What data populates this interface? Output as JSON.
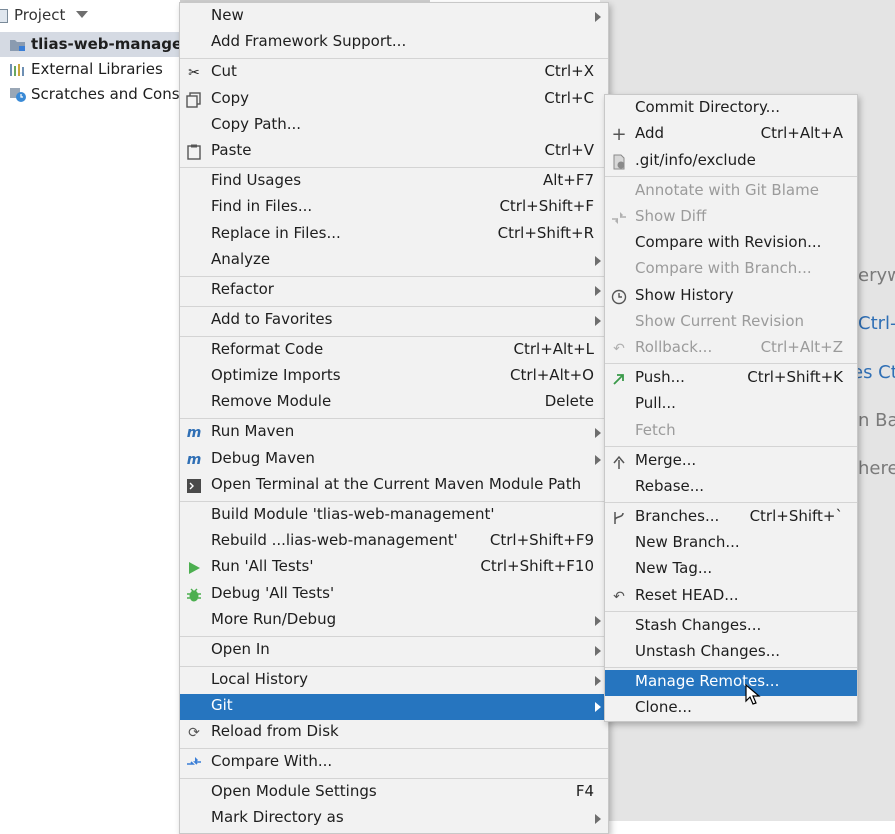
{
  "project_panel": {
    "title": "Project",
    "tree": [
      {
        "label": "tlias-web-management",
        "icon": "module-folder-icon"
      },
      {
        "label": "External Libraries",
        "icon": "libraries-icon"
      },
      {
        "label": "Scratches and Consoles",
        "icon": "scratches-icon"
      }
    ]
  },
  "editor_hints": [
    {
      "text": "eryw"
    },
    {
      "text": "Ctrl-"
    },
    {
      "text": "es Ct"
    },
    {
      "text": "n Ba"
    },
    {
      "text": "here"
    }
  ],
  "main_menu": [
    {
      "label": "New",
      "submenu": true
    },
    {
      "label": "Add Framework Support..."
    },
    {
      "label": "Cut",
      "shortcut": "Ctrl+X",
      "icon": "scissors-icon"
    },
    {
      "label": "Copy",
      "shortcut": "Ctrl+C",
      "icon": "copy-icon"
    },
    {
      "label": "Copy Path..."
    },
    {
      "label": "Paste",
      "shortcut": "Ctrl+V",
      "icon": "paste-icon"
    },
    {
      "label": "Find Usages",
      "shortcut": "Alt+F7"
    },
    {
      "label": "Find in Files...",
      "shortcut": "Ctrl+Shift+F"
    },
    {
      "label": "Replace in Files...",
      "shortcut": "Ctrl+Shift+R"
    },
    {
      "label": "Analyze",
      "submenu": true
    },
    {
      "label": "Refactor",
      "submenu": true
    },
    {
      "label": "Add to Favorites",
      "submenu": true
    },
    {
      "label": "Reformat Code",
      "shortcut": "Ctrl+Alt+L"
    },
    {
      "label": "Optimize Imports",
      "shortcut": "Ctrl+Alt+O"
    },
    {
      "label": "Remove Module",
      "shortcut": "Delete"
    },
    {
      "label": "Run Maven",
      "submenu": true,
      "icon": "maven-run-icon"
    },
    {
      "label": "Debug Maven",
      "submenu": true,
      "icon": "maven-debug-icon"
    },
    {
      "label": "Open Terminal at the Current Maven Module Path",
      "icon": "terminal-icon"
    },
    {
      "label": "Build Module 'tlias-web-management'"
    },
    {
      "label": "Rebuild ...lias-web-management'",
      "shortcut": "Ctrl+Shift+F9"
    },
    {
      "label": "Run 'All Tests'",
      "shortcut": "Ctrl+Shift+F10",
      "icon": "run-icon"
    },
    {
      "label": "Debug 'All Tests'",
      "icon": "debug-bug-icon"
    },
    {
      "label": "More Run/Debug",
      "submenu": true
    },
    {
      "label": "Open In",
      "submenu": true
    },
    {
      "label": "Local History",
      "submenu": true
    },
    {
      "label": "Git",
      "submenu": true
    },
    {
      "label": "Reload from Disk",
      "icon": "reload-icon"
    },
    {
      "label": "Compare With...",
      "icon": "compare-icon"
    },
    {
      "label": "Open Module Settings",
      "shortcut": "F4"
    },
    {
      "label": "Mark Directory as",
      "submenu": true
    }
  ],
  "git_submenu": [
    {
      "label": "Commit Directory..."
    },
    {
      "label": "Add",
      "shortcut": "Ctrl+Alt+A",
      "icon": "plus-icon"
    },
    {
      "label": ".git/info/exclude",
      "icon": "ignore-file-icon"
    },
    {
      "label": "Annotate with Git Blame",
      "disabled": true
    },
    {
      "label": "Show Diff",
      "disabled": true,
      "icon": "diff-icon"
    },
    {
      "label": "Compare with Revision..."
    },
    {
      "label": "Compare with Branch...",
      "disabled": true
    },
    {
      "label": "Show History",
      "icon": "history-clock-icon"
    },
    {
      "label": "Show Current Revision",
      "disabled": true
    },
    {
      "label": "Rollback...",
      "shortcut": "Ctrl+Alt+Z",
      "disabled": true,
      "icon": "rollback-icon"
    },
    {
      "label": "Push...",
      "shortcut": "Ctrl+Shift+K",
      "icon": "push-arrow-icon"
    },
    {
      "label": "Pull..."
    },
    {
      "label": "Fetch",
      "disabled": true
    },
    {
      "label": "Merge...",
      "icon": "merge-icon"
    },
    {
      "label": "Rebase..."
    },
    {
      "label": "Branches...",
      "shortcut": "Ctrl+Shift+`",
      "icon": "branch-icon"
    },
    {
      "label": "New Branch..."
    },
    {
      "label": "New Tag..."
    },
    {
      "label": "Reset HEAD...",
      "icon": "reset-icon"
    },
    {
      "label": "Stash Changes..."
    },
    {
      "label": "Unstash Changes..."
    },
    {
      "label": "Manage Remotes..."
    },
    {
      "label": "Clone..."
    }
  ],
  "colors": {
    "selection": "#2675bf",
    "menu_bg": "#f2f2f2",
    "disabled_text": "#9b9b9b"
  }
}
